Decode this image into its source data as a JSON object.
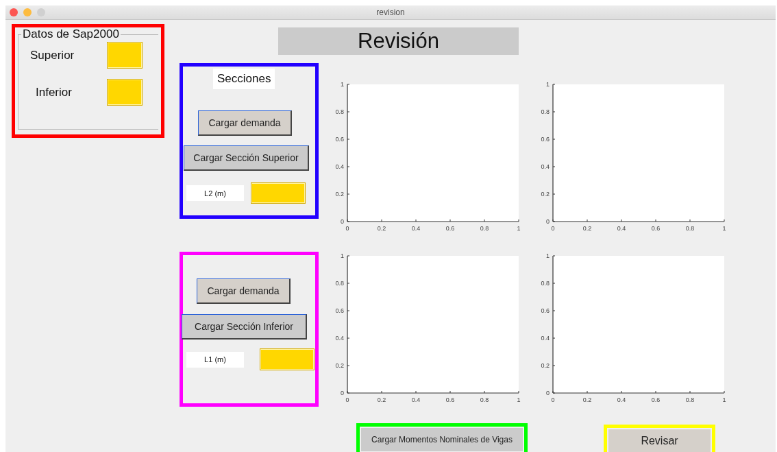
{
  "window": {
    "title": "revision"
  },
  "datos_panel": {
    "title": "Datos de Sap2000",
    "color": "#ff0000",
    "fields": [
      {
        "label": "Superior"
      },
      {
        "label": "Inferior"
      }
    ]
  },
  "header": {
    "title": "Revisión"
  },
  "upper_panel": {
    "title": "Secciones",
    "color": "#2200ff",
    "buttons": [
      "Cargar demanda",
      "Cargar Sección Superior"
    ],
    "length_label": "L2 (m)"
  },
  "lower_panel": {
    "color": "#ff00ff",
    "buttons": [
      "Cargar demanda",
      "Cargar Sección Inferior"
    ],
    "length_label": "L1 (m)"
  },
  "charts": [
    {
      "chart_data": {
        "type": "line",
        "xlim": [
          0,
          1
        ],
        "ylim": [
          0,
          1
        ],
        "xticks": [
          0,
          0.2,
          0.4,
          0.6,
          0.8,
          1
        ],
        "yticks": [
          0,
          0.2,
          0.4,
          0.6,
          0.8,
          1
        ]
      }
    },
    {
      "chart_data": {
        "type": "line",
        "xlim": [
          0,
          1
        ],
        "ylim": [
          0,
          1
        ],
        "xticks": [
          0,
          0.2,
          0.4,
          0.6,
          0.8,
          1
        ],
        "yticks": [
          0,
          0.2,
          0.4,
          0.6,
          0.8,
          1
        ]
      }
    },
    {
      "chart_data": {
        "type": "line",
        "xlim": [
          0,
          1
        ],
        "ylim": [
          0,
          1
        ],
        "xticks": [
          0,
          0.2,
          0.4,
          0.6,
          0.8,
          1
        ],
        "yticks": [
          0,
          0.2,
          0.4,
          0.6,
          0.8,
          1
        ]
      }
    },
    {
      "chart_data": {
        "type": "line",
        "xlim": [
          0,
          1
        ],
        "ylim": [
          0,
          1
        ],
        "xticks": [
          0,
          0.2,
          0.4,
          0.6,
          0.8,
          1
        ],
        "yticks": [
          0,
          0.2,
          0.4,
          0.6,
          0.8,
          1
        ]
      }
    }
  ],
  "bottom_buttons": [
    {
      "label": "Cargar Momentos Nominales de Vigas",
      "color": "#00ff00"
    },
    {
      "label": "Revisar",
      "color": "#ffff00"
    }
  ]
}
